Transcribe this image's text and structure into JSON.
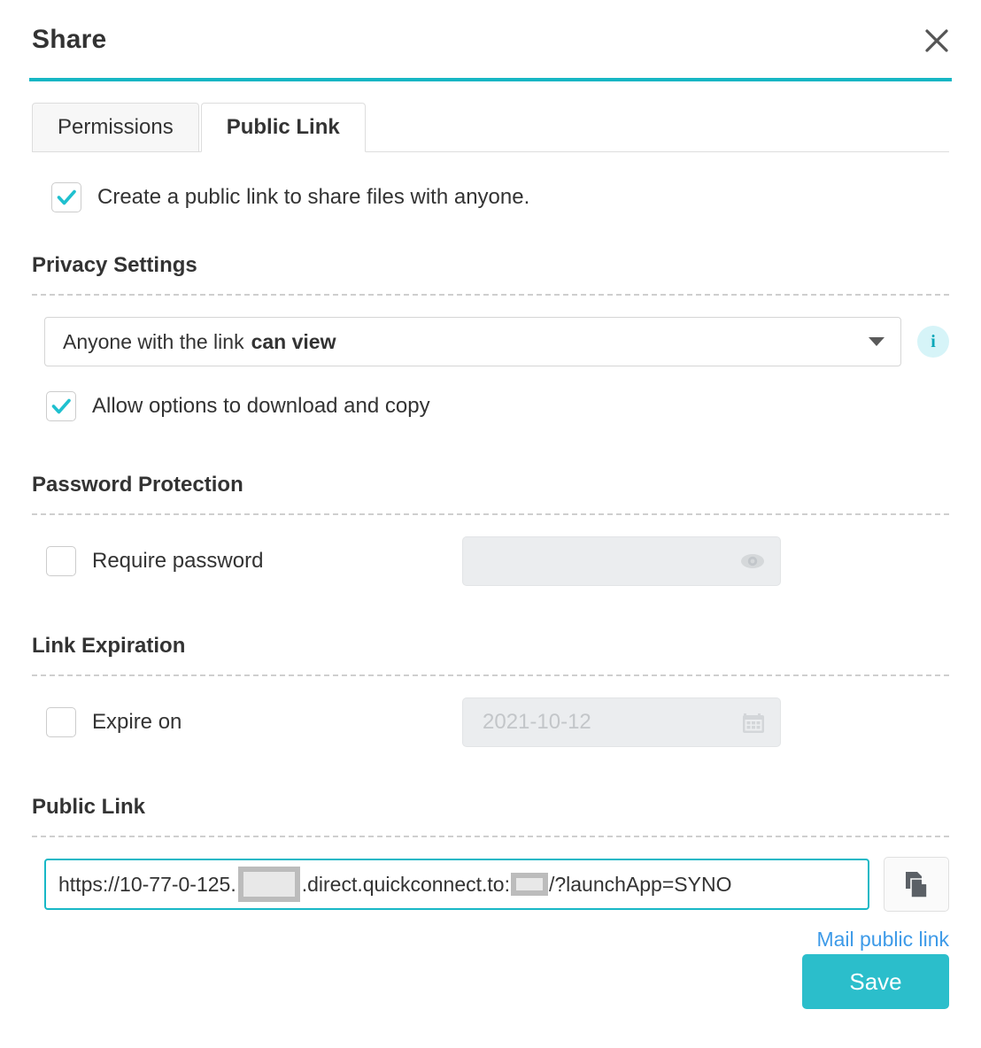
{
  "dialog": {
    "title": "Share",
    "close_label": "×"
  },
  "tabs": [
    {
      "label": "Permissions",
      "active": false
    },
    {
      "label": "Public Link",
      "active": true
    }
  ],
  "create_link": {
    "label": "Create a public link to share files with anyone.",
    "checked": true
  },
  "privacy": {
    "heading": "Privacy Settings",
    "select_prefix": "Anyone with the link",
    "select_strong": "can view",
    "info_glyph": "i",
    "allow_download": {
      "label": "Allow options to download and copy",
      "checked": true
    }
  },
  "password": {
    "heading": "Password Protection",
    "require_label": "Require password",
    "checked": false,
    "value": "",
    "placeholder": ""
  },
  "expiration": {
    "heading": "Link Expiration",
    "expire_label": "Expire on",
    "checked": false,
    "date": "2021-10-12"
  },
  "public_link": {
    "heading": "Public Link",
    "url_part1": "https://10-77-0-125.",
    "url_part2": ".direct.quickconnect.to:",
    "url_part3": "/?launchApp=SYNO",
    "mail_label": "Mail public link"
  },
  "footer": {
    "save_label": "Save"
  },
  "colors": {
    "accent": "#15b6c4",
    "save": "#2bbecb",
    "link": "#3d9ae8",
    "info_bg": "#d6f4f8",
    "info_fg": "#0ba7b8"
  }
}
